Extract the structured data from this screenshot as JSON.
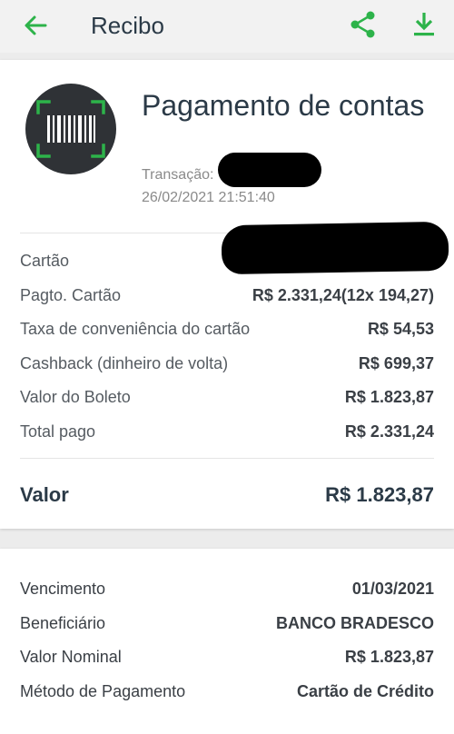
{
  "appbar": {
    "title": "Recibo",
    "back_icon": "arrow-left-icon",
    "share_icon": "share-icon",
    "download_icon": "download-icon",
    "accent_color": "#2db34a"
  },
  "header": {
    "headline": "Pagamento de contas",
    "transaction_label": "Transação:",
    "datetime": "26/02/2021 21:51:40",
    "logo_icon": "barcode-scan-icon"
  },
  "details": [
    {
      "label": "Cartão",
      "value": ""
    },
    {
      "label": "Pagto. Cartão",
      "value": "R$ 2.331,24(12x 194,27)"
    },
    {
      "label": "Taxa de conveniência do cartão",
      "value": "R$ 54,53"
    },
    {
      "label": "Cashback (dinheiro de volta)",
      "value": "R$ 699,37"
    },
    {
      "label": "Valor do Boleto",
      "value": "R$ 1.823,87"
    },
    {
      "label": "Total pago",
      "value": "R$ 2.331,24"
    }
  ],
  "total": {
    "label": "Valor",
    "value": "R$ 1.823,87"
  },
  "bill": [
    {
      "label": "Vencimento",
      "value": "01/03/2021"
    },
    {
      "label": "Beneficiário",
      "value": "BANCO BRADESCO"
    },
    {
      "label": "Valor Nominal",
      "value": "R$ 1.823,87"
    },
    {
      "label": "Método de Pagamento",
      "value": "Cartão de Crédito"
    }
  ]
}
